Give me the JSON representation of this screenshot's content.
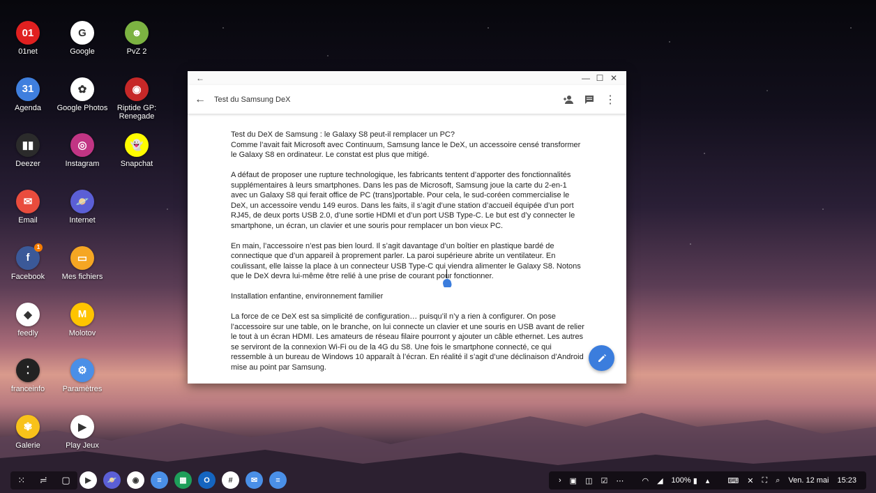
{
  "desktop": {
    "apps": [
      {
        "label": "01net",
        "color": "#e02020",
        "glyph": "01",
        "icon": "01net-icon"
      },
      {
        "label": "Google",
        "color": "#ffffff",
        "glyph": "G",
        "icon": "google-icon"
      },
      {
        "label": "PvZ 2",
        "color": "#7cb342",
        "glyph": "☻",
        "icon": "pvz2-icon"
      },
      {
        "label": "Agenda",
        "color": "#3f7fde",
        "glyph": "31",
        "icon": "calendar-icon"
      },
      {
        "label": "Google Photos",
        "color": "#ffffff",
        "glyph": "✿",
        "icon": "google-photos-icon"
      },
      {
        "label": "Riptide GP: Renegade",
        "color": "#c62828",
        "glyph": "◉",
        "icon": "riptide-icon"
      },
      {
        "label": "Deezer",
        "color": "#2b2b2b",
        "glyph": "▮▮",
        "icon": "deezer-icon"
      },
      {
        "label": "Instagram",
        "color": "#c13584",
        "glyph": "◎",
        "icon": "instagram-icon"
      },
      {
        "label": "Snapchat",
        "color": "#fffc00",
        "glyph": "👻",
        "icon": "snapchat-icon"
      },
      {
        "label": "Email",
        "color": "#e94c3d",
        "glyph": "✉",
        "icon": "email-icon"
      },
      {
        "label": "Internet",
        "color": "#5b5fd6",
        "glyph": "🪐",
        "icon": "internet-icon"
      },
      {
        "label": "Facebook",
        "color": "#3b5998",
        "glyph": "f",
        "icon": "facebook-icon",
        "badge": "1"
      },
      {
        "label": "Mes fichiers",
        "color": "#f5a623",
        "glyph": "▭",
        "icon": "files-icon"
      },
      {
        "label": "feedly",
        "color": "#ffffff",
        "glyph": "◆",
        "icon": "feedly-icon"
      },
      {
        "label": "Molotov",
        "color": "#ffc400",
        "glyph": "M",
        "icon": "molotov-icon"
      },
      {
        "label": "franceinfo",
        "color": "#222222",
        "glyph": "⁚",
        "icon": "franceinfo-icon"
      },
      {
        "label": "Paramètres",
        "color": "#4a8fe7",
        "glyph": "⚙",
        "icon": "settings-icon"
      },
      {
        "label": "Galerie",
        "color": "#f8c21a",
        "glyph": "✾",
        "icon": "gallery-icon"
      },
      {
        "label": "Play Jeux",
        "color": "#ffffff",
        "glyph": "▶",
        "icon": "play-games-icon"
      }
    ]
  },
  "window": {
    "doc_title": "Test du Samsung DeX",
    "paragraphs": [
      "Test du DeX de Samsung : le Galaxy S8 peut-il remplacer un PC?\nComme l’avait fait Microsoft avec Continuum, Samsung lance le DeX, un accessoire censé transformer le Galaxy S8 en ordinateur. Le constat est plus que mitigé.",
      "A défaut de proposer une rupture technologique, les fabricants tentent d’apporter des fonctionnalités supplémentaires à leurs smartphones. Dans les pas de Microsoft, Samsung joue la carte du 2-en-1 avec un Galaxy S8 qui ferait office de PC (trans)portable. Pour cela, le sud-coréen commercialise le DeX, un accessoire vendu 149 euros. Dans les faits, il s’agit d’une station d’accueil équipée d’un port RJ45, de deux ports USB 2.0, d’une sortie HDMI et d’un port USB Type-C. Le but est d’y connecter le smartphone, un écran, un clavier et une souris pour remplacer un bon vieux PC.",
      "En main, l’accessoire n’est pas bien lourd. Il s’agit davantage d’un boîtier en plastique bardé de connectique que d’un appareil à proprement parler. La paroi supérieure abrite un ventilateur. En coulissant, elle laisse la place à un connecteur USB Type-C qui viendra alimenter le Galaxy S8. Notons que le DeX devra lui-même être relié à une prise de courant pour fonctionner.",
      "Installation enfantine, environnement familier",
      "La force de ce DeX est sa simplicité de configuration… puisqu’il n’y a rien à configurer. On pose l’accessoire sur une table, on le branche, on lui connecte un clavier et une souris en USB avant de relier le tout à un écran HDMI. Les amateurs de réseau filaire pourront y ajouter un câble ethernet. Les autres se serviront de la connexion Wi-Fi ou de la 4G du S8. Une fois le smartphone connecté, ce qui ressemble à un bureau de Windows 10 apparaît à l’écran. En réalité il s’agit d’une déclinaison d’Android mise au point par Samsung."
    ]
  },
  "taskbar": {
    "apps": [
      {
        "icon": "play-store-icon",
        "color": "#ffffff",
        "glyph": "▶"
      },
      {
        "icon": "internet-icon",
        "color": "#5b5fd6",
        "glyph": "🪐"
      },
      {
        "icon": "chrome-icon",
        "color": "#ffffff",
        "glyph": "◉"
      },
      {
        "icon": "google-docs-icon",
        "color": "#4a8fe7",
        "glyph": "≡"
      },
      {
        "icon": "google-sheets-icon",
        "color": "#1e9e5a",
        "glyph": "▦"
      },
      {
        "icon": "outlook-icon",
        "color": "#1565c0",
        "glyph": "O"
      },
      {
        "icon": "slack-icon",
        "color": "#ffffff",
        "glyph": "#"
      },
      {
        "icon": "email-icon",
        "color": "#4a8fe7",
        "glyph": "✉"
      },
      {
        "icon": "google-docs-icon",
        "color": "#4a8fe7",
        "glyph": "≡"
      }
    ],
    "battery": "100%",
    "date": "Ven. 12 mai",
    "time": "15:23"
  }
}
